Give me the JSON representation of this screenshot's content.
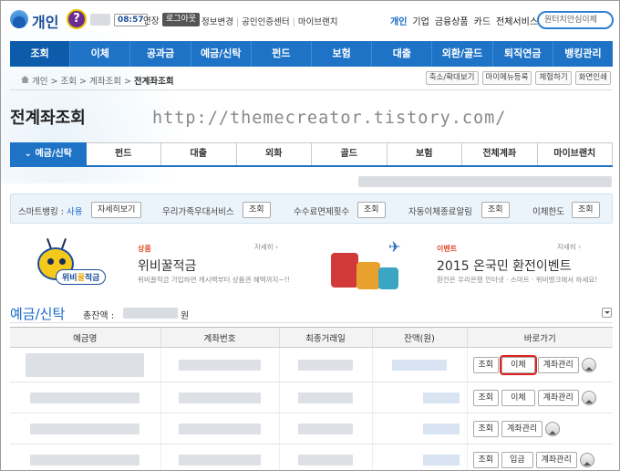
{
  "header": {
    "logo_text": "개인",
    "help_label": "?",
    "session_time": "08:57",
    "extend_label": "연장",
    "logout_label": "로그아웃",
    "top_links": [
      "정보변경",
      "공인인증센터",
      "마이브랜치"
    ],
    "right_nav": [
      "개인",
      "기업",
      "금융상품",
      "카드",
      "전체서비스 ▾"
    ],
    "search_placeholder": "원터치안심이체"
  },
  "main_nav": [
    "조회",
    "이체",
    "공과금",
    "예금/신탁",
    "펀드",
    "보험",
    "대출",
    "외환/골드",
    "퇴직연금",
    "뱅킹관리"
  ],
  "breadcrumb": {
    "items": [
      "개인",
      "조회",
      "계좌조회"
    ],
    "current": "전계좌조회"
  },
  "util_buttons": [
    "축소/확대보기",
    "마이메뉴등록",
    "체험하기",
    "화면인쇄"
  ],
  "page_title": "전계좌조회",
  "watermark": "http://themecreator.tistory.com/",
  "sub_tabs": [
    "예금/신탁",
    "펀드",
    "대출",
    "외화",
    "골드",
    "보험",
    "전체계좌",
    "마이브랜치"
  ],
  "quick_bar": {
    "smart_label": "스마트뱅킹 : ",
    "smart_value": "사용",
    "detail_btn": "자세히보기",
    "family_label": "우리가족우대서비스",
    "fee_label": "수수료면제횟수",
    "auto_label": "자동이체종료알림",
    "limit_label": "이체한도",
    "view_btn": "조회"
  },
  "banners": [
    {
      "category": "상품",
      "title": "위비꿀적금",
      "desc": "위비꿀적금 가입하면 캐시백부터 상품권 혜택까지~!!",
      "more": "자세히 ›",
      "tag_a": "위비",
      "tag_b": "꿀",
      "tag_c": "적금"
    },
    {
      "category": "이벤트",
      "title": "2015 온국민 환전이벤트",
      "desc": "환전은 우리은행 인터넷 · 스마트 · 위비뱅크에서 하세요!",
      "more": "자세히 ›"
    }
  ],
  "accounts": {
    "section_title": "예금/신탁",
    "total_label": "총잔액 :",
    "total_unit": "원",
    "columns": [
      "예금명",
      "계좌번호",
      "최종거래일",
      "잔액(원)",
      "바로가기"
    ],
    "rows": [
      {
        "actions": [
          "조회",
          "이체",
          "계좌관리"
        ],
        "highlight": "이체"
      },
      {
        "actions": [
          "조회",
          "이체",
          "계좌관리"
        ],
        "highlight": ""
      },
      {
        "actions": [
          "조회",
          "계좌관리"
        ],
        "highlight": ""
      },
      {
        "actions": [
          "조회",
          "입금",
          "계좌관리"
        ],
        "highlight": ""
      }
    ]
  },
  "colors": {
    "primary": "#1f73c7",
    "highlight": "#e02020",
    "accent_blue": "#1869c8"
  }
}
